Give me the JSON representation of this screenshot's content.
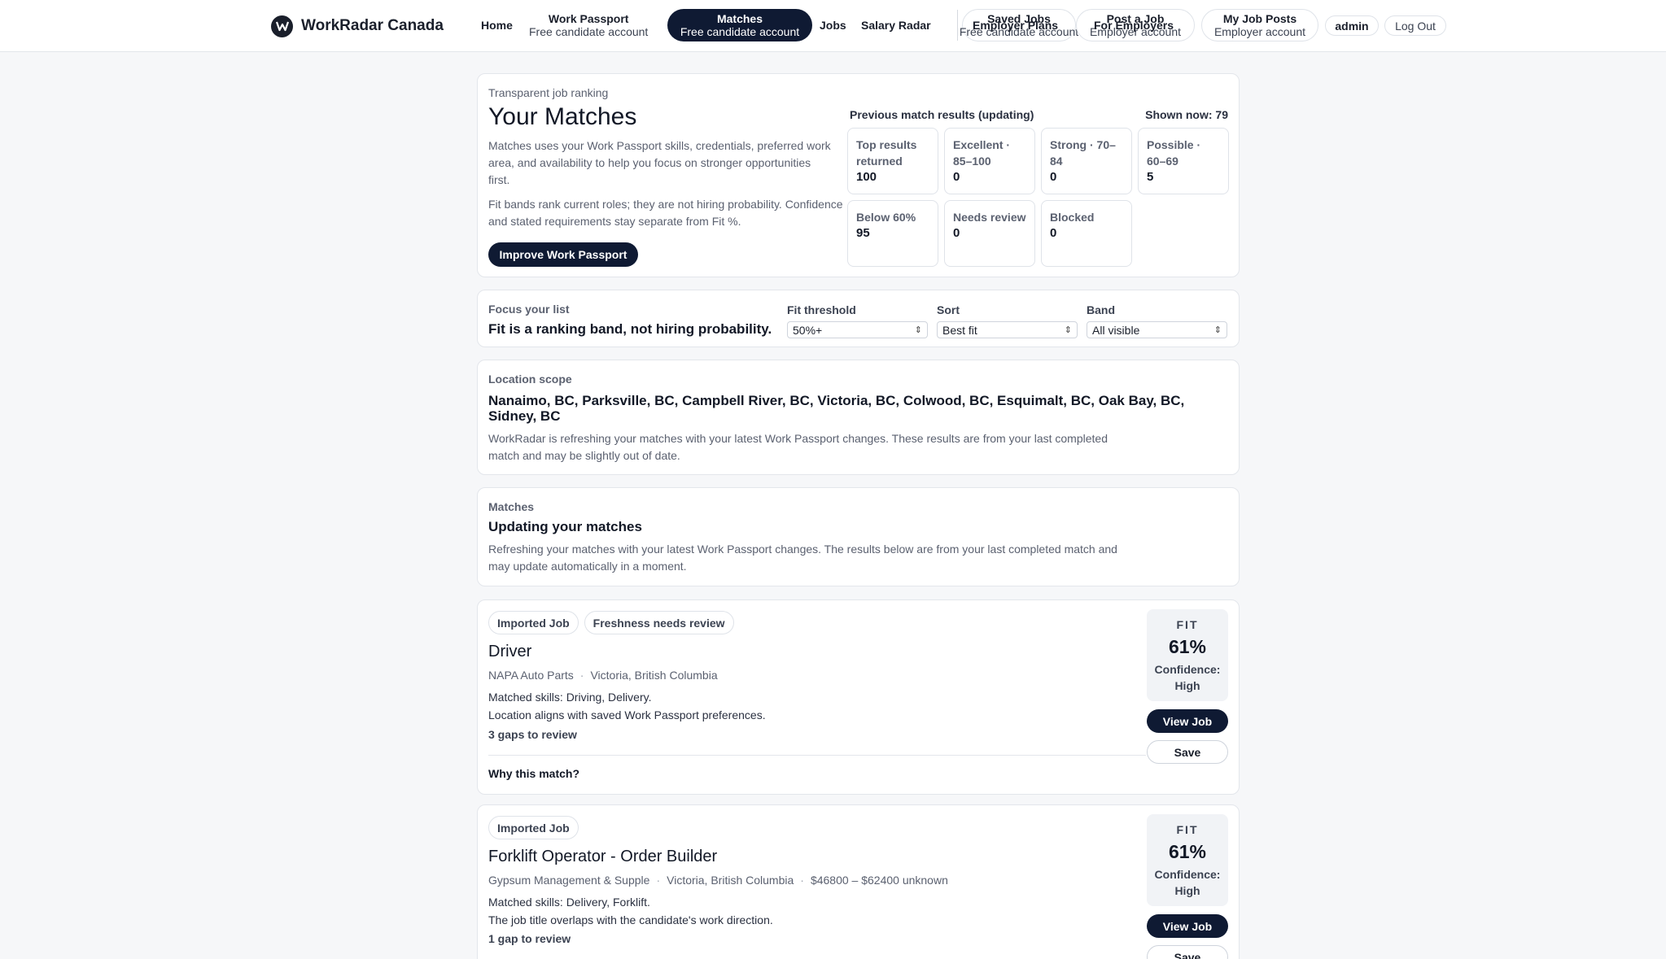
{
  "brand": {
    "name": "WorkRadar Canada"
  },
  "nav": {
    "home": "Home",
    "work_passport": {
      "label": "Work Passport",
      "sub": "Free candidate account"
    },
    "matches": {
      "label": "Matches",
      "sub": "Free candidate account"
    },
    "jobs": "Jobs",
    "salary_radar": "Salary Radar",
    "saved_jobs": {
      "label": "Saved Jobs",
      "sub": "Free candidate account"
    },
    "employer_plans": "Employer Plans",
    "post_a_job": {
      "label": "Post a Job",
      "sub": "Employer account"
    },
    "for_employers": "For Employers",
    "my_job_posts": {
      "label": "My Job Posts",
      "sub": "Employer account"
    },
    "admin": "admin",
    "logout": "Log Out"
  },
  "hero": {
    "eyebrow": "Transparent job ranking",
    "title": "Your Matches",
    "desc": "Matches uses your Work Passport skills, credentials, preferred work area, and availability to help you focus on stronger opportunities first.",
    "desc2": "Fit bands rank current roles; they are not hiring probability. Confidence and stated requirements stay separate from Fit %.",
    "button": "Improve Work Passport",
    "stats_heading": "Previous match results (updating)",
    "shown_now": "Shown now: 79",
    "stats": [
      {
        "label": "Top results returned",
        "value": "100"
      },
      {
        "label": "Excellent · 85–100",
        "value": "0"
      },
      {
        "label": "Strong · 70–84",
        "value": "0"
      },
      {
        "label": "Possible · 60–69",
        "value": "5"
      },
      {
        "label": "Below 60%",
        "value": "95"
      },
      {
        "label": "Needs review",
        "value": "0"
      },
      {
        "label": "Blocked",
        "value": "0"
      }
    ]
  },
  "focus": {
    "eyebrow": "Focus your list",
    "title": "Fit is a ranking band, not hiring probability.",
    "fit_threshold": {
      "label": "Fit threshold",
      "value": "50%+"
    },
    "sort": {
      "label": "Sort",
      "value": "Best fit"
    },
    "band": {
      "label": "Band",
      "value": "All visible"
    }
  },
  "location": {
    "eyebrow": "Location scope",
    "title": "Nanaimo, BC, Parksville, BC, Campbell River, BC, Victoria, BC, Colwood, BC, Esquimalt, BC, Oak Bay, BC, Sidney, BC",
    "desc": "WorkRadar is refreshing your matches with your latest Work Passport changes. These results are from your last completed match and may be slightly out of date."
  },
  "status": {
    "eyebrow": "Matches",
    "title": "Updating your matches",
    "desc": "Refreshing your matches with your latest Work Passport changes. The results below are from your last completed match and may update automatically in a moment."
  },
  "jobs": [
    {
      "tags": [
        "Imported Job",
        "Freshness needs review"
      ],
      "title": "Driver",
      "company": "NAPA Auto Parts",
      "location": "Victoria, British Columbia",
      "salary": "",
      "line1": "Matched skills: Driving, Delivery.",
      "line2": "Location aligns with saved Work Passport preferences.",
      "gaps": "3 gaps to review",
      "why": "Why this match?",
      "fit_label": "FIT",
      "fit": "61%",
      "confidence": "Confidence: High",
      "view": "View Job",
      "save": "Save"
    },
    {
      "tags": [
        "Imported Job"
      ],
      "title": "Forklift Operator - Order Builder",
      "company": "Gypsum Management & Supple",
      "location": "Victoria, British Columbia",
      "salary": "$46800 – $62400 unknown",
      "line1": "Matched skills: Delivery, Forklift.",
      "line2": "The job title overlaps with the candidate's work direction.",
      "gaps": "1 gap to review",
      "fit_label": "FIT",
      "fit": "61%",
      "confidence": "Confidence: High",
      "view": "View Job",
      "save": "Save"
    }
  ]
}
